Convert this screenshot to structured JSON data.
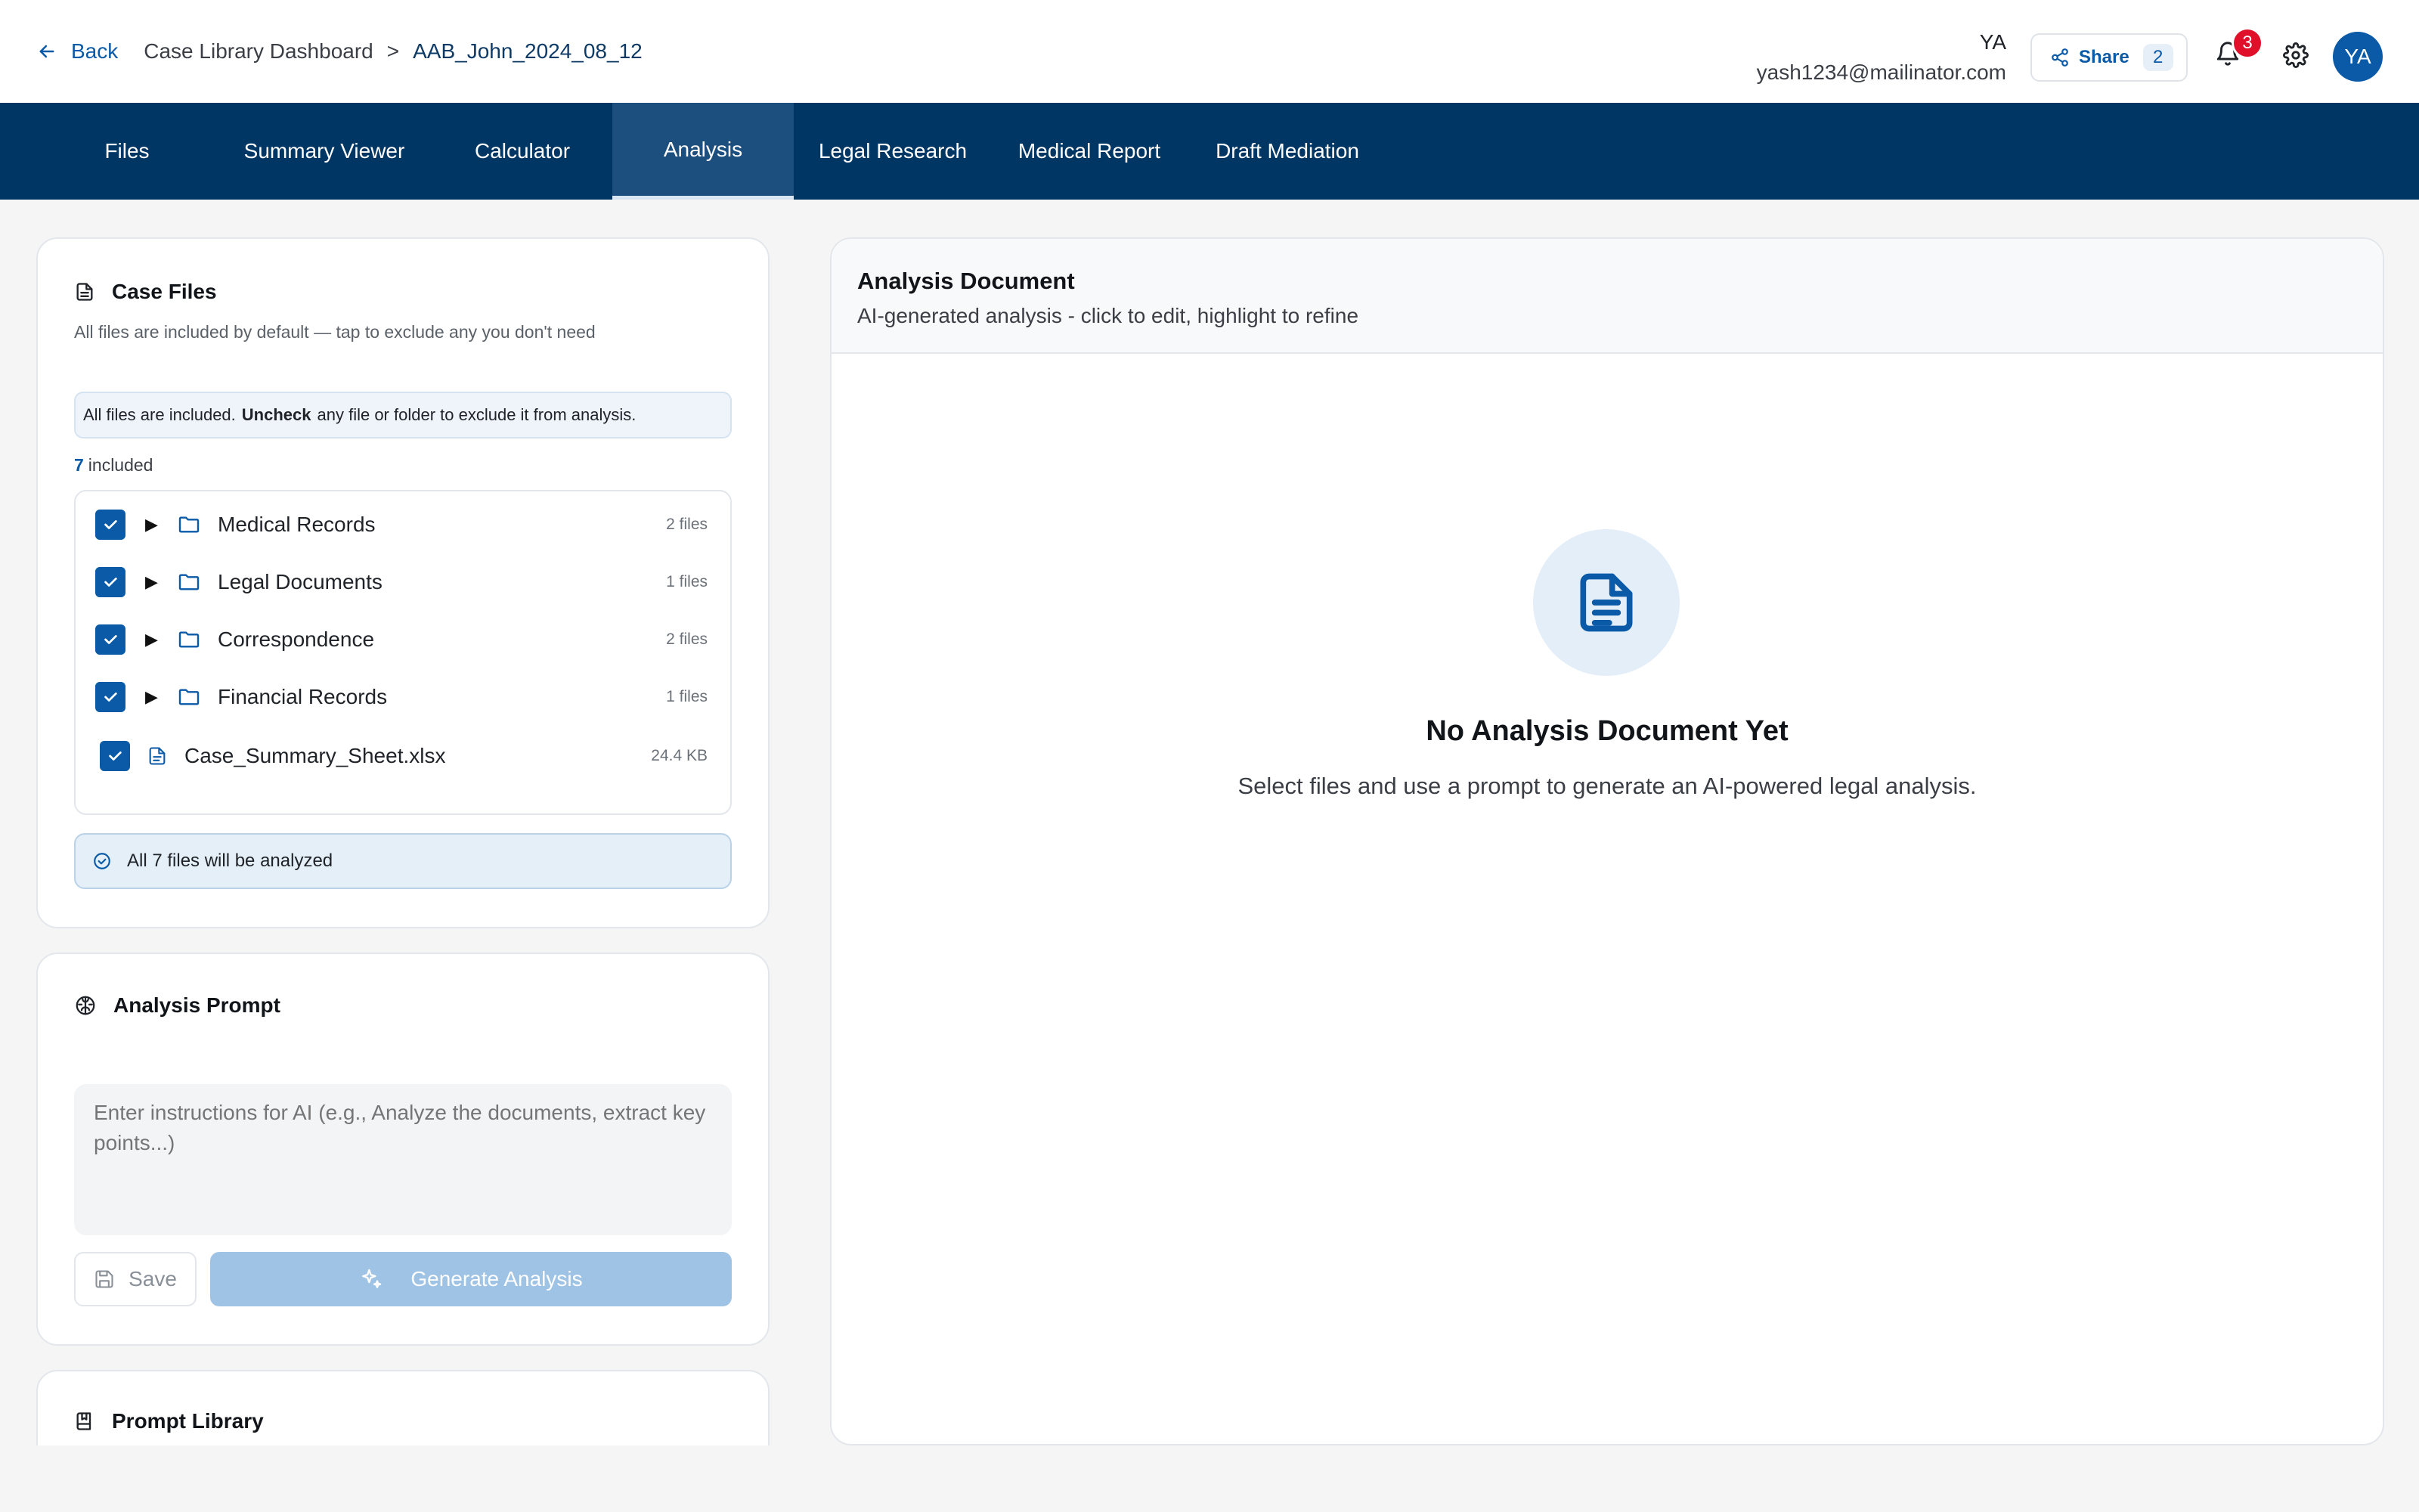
{
  "header": {
    "back_label": "Back",
    "breadcrumb": {
      "parent": "Case Library Dashboard",
      "separator": ">",
      "current": "AAB_John_2024_08_12"
    },
    "user": {
      "initials": "YA",
      "email": "yash1234@mailinator.com"
    },
    "share": {
      "label": "Share",
      "count": "2"
    },
    "notifications": {
      "count": "3"
    },
    "avatar": "YA"
  },
  "tabs": [
    {
      "label": "Files"
    },
    {
      "label": "Summary Viewer"
    },
    {
      "label": "Calculator"
    },
    {
      "label": "Analysis",
      "active": true
    },
    {
      "label": "Legal Research"
    },
    {
      "label": "Medical Report"
    },
    {
      "label": "Draft Mediation"
    }
  ],
  "case_files": {
    "title": "Case Files",
    "subtitle": "All files are included by default — tap to exclude any you don't need",
    "note": {
      "prefix": "All files are included.",
      "bold": "Uncheck",
      "suffix": "any file or folder to exclude it from analysis."
    },
    "included_count": "7",
    "included_label": "included",
    "items": [
      {
        "type": "folder",
        "name": "Medical Records",
        "meta": "2 files",
        "checked": true
      },
      {
        "type": "folder",
        "name": "Legal Documents",
        "meta": "1 files",
        "checked": true
      },
      {
        "type": "folder",
        "name": "Correspondence",
        "meta": "2 files",
        "checked": true
      },
      {
        "type": "folder",
        "name": "Financial Records",
        "meta": "1 files",
        "checked": true
      },
      {
        "type": "file",
        "name": "Case_Summary_Sheet.xlsx",
        "meta": "24.4 KB",
        "checked": true
      }
    ],
    "summary": "All 7 files will be analyzed"
  },
  "analysis_prompt": {
    "title": "Analysis Prompt",
    "placeholder": "Enter instructions for AI (e.g., Analyze the documents, extract key points...)",
    "save_label": "Save",
    "generate_label": "Generate Analysis"
  },
  "prompt_library": {
    "title": "Prompt Library"
  },
  "analysis_document": {
    "title": "Analysis Document",
    "subtitle": "AI-generated analysis - click to edit, highlight to refine",
    "empty_title": "No Analysis Document Yet",
    "empty_text": "Select files and use a prompt to generate an AI-powered legal analysis."
  },
  "colors": {
    "brand_navy": "#003663",
    "active_tab": "#1c4f7d",
    "accent_blue": "#0a5aa8",
    "badge_red": "#e0102a",
    "generate_disabled": "#9ec3e4"
  }
}
